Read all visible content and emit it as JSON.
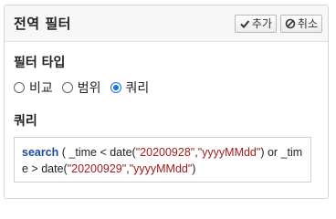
{
  "panel": {
    "title": "전역 필터",
    "add_label": "추가",
    "cancel_label": "취소"
  },
  "filter_type": {
    "label": "필터 타입",
    "options": [
      "비교",
      "범위",
      "쿼리"
    ],
    "selected": "쿼리"
  },
  "query": {
    "label": "쿼리",
    "keyword": "search",
    "text_1": " ( _time < date(",
    "str_1": "\"20200928\"",
    "text_2": ",",
    "str_2": "\"yyyyMMdd\"",
    "text_3": ") or _time > date(",
    "str_3": "\"20200929\"",
    "text_4": ",",
    "str_4": "\"yyyyMMdd\"",
    "text_5": ")"
  },
  "colors": {
    "accent": "#1a73e8",
    "keyword": "#1a4a9c",
    "string": "#a11c1c"
  }
}
